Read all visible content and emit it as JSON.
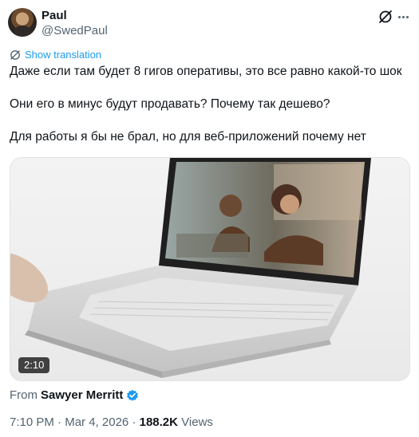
{
  "author": {
    "display_name": "Paul",
    "handle": "@SwedPaul",
    "avatar_icon": "avatar-photo"
  },
  "actions": {
    "grok_icon": "grok-icon",
    "more_icon": "more-icon"
  },
  "translation": {
    "label": "Show translation",
    "icon": "translate-icon"
  },
  "tweet": {
    "lines": [
      "Даже если там будет 8 гигов оперативы, это все равно какой-то шок",
      "Они его в минус будут продавать? Почему так дешево?",
      "Для работы я бы не брал, но для веб-приложений почему нет"
    ]
  },
  "media": {
    "duration": "2:10"
  },
  "source": {
    "prefix": "From",
    "name": "Sawyer Merritt",
    "verified_icon": "verified-badge-icon"
  },
  "meta": {
    "time": "7:10 PM",
    "separator": "·",
    "date": "Mar 4, 2026",
    "views_count": "188.2K",
    "views_label": "Views"
  },
  "colors": {
    "accent": "#1d9bf0",
    "text": "#0f1419",
    "muted": "#536471"
  }
}
